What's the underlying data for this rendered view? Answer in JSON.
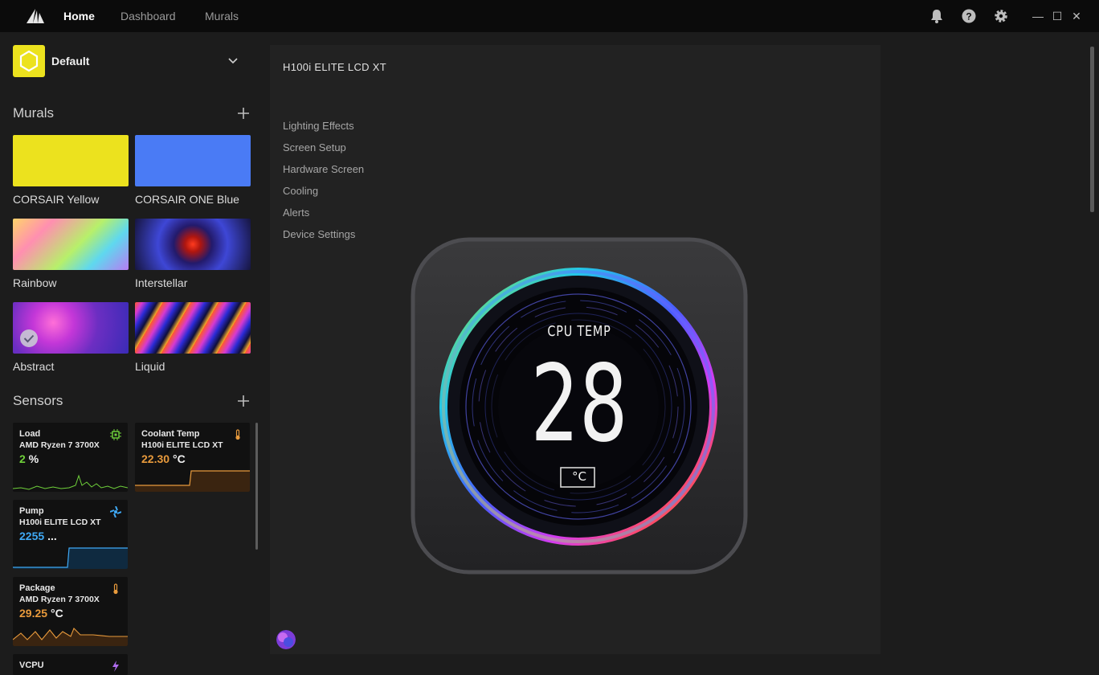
{
  "nav": {
    "home": "Home",
    "dashboard": "Dashboard",
    "murals": "Murals"
  },
  "top_icons": [
    "bell-icon",
    "help-icon",
    "gear-icon"
  ],
  "window": {
    "minimize": "—",
    "maximize": "☐",
    "close": "✕"
  },
  "profile": {
    "name": "Default",
    "color": "#ece21e"
  },
  "murals": {
    "title": "Murals",
    "items": [
      {
        "label": "CORSAIR Yellow"
      },
      {
        "label": "CORSAIR ONE Blue"
      },
      {
        "label": "Rainbow"
      },
      {
        "label": "Interstellar"
      },
      {
        "label": "Abstract",
        "selected": true
      },
      {
        "label": "Liquid"
      }
    ]
  },
  "sensors": {
    "title": "Sensors",
    "items": [
      {
        "name": "Load",
        "device": "AMD Ryzen 7 3700X",
        "value": "2",
        "unit": "%",
        "color": "#6fd13a",
        "icon": "cpu-chip-icon"
      },
      {
        "name": "Coolant Temp",
        "device": "H100i ELITE LCD XT",
        "value": "22.30",
        "unit": "°C",
        "color": "#e89a3c",
        "icon": "thermometer-icon"
      },
      {
        "name": "Pump",
        "device": "H100i ELITE LCD XT",
        "value": "2255",
        "unit": "...",
        "color": "#3fa9f5",
        "icon": "pump-icon"
      },
      {
        "name": "Package",
        "device": "AMD Ryzen 7 3700X",
        "value": "29.25",
        "unit": "°C",
        "color": "#e89a3c",
        "icon": "thermometer-icon"
      },
      {
        "name": "VCPU",
        "device": "",
        "value": "",
        "unit": "",
        "color": "#b06cf0",
        "icon": "voltage-icon"
      }
    ]
  },
  "device": {
    "title": "H100i ELITE LCD XT",
    "menu": [
      "Lighting Effects",
      "Screen Setup",
      "Hardware Screen",
      "Cooling",
      "Alerts",
      "Device Settings"
    ],
    "lcd": {
      "label": "CPU TEMP",
      "value": "28",
      "unit": "°C"
    }
  }
}
